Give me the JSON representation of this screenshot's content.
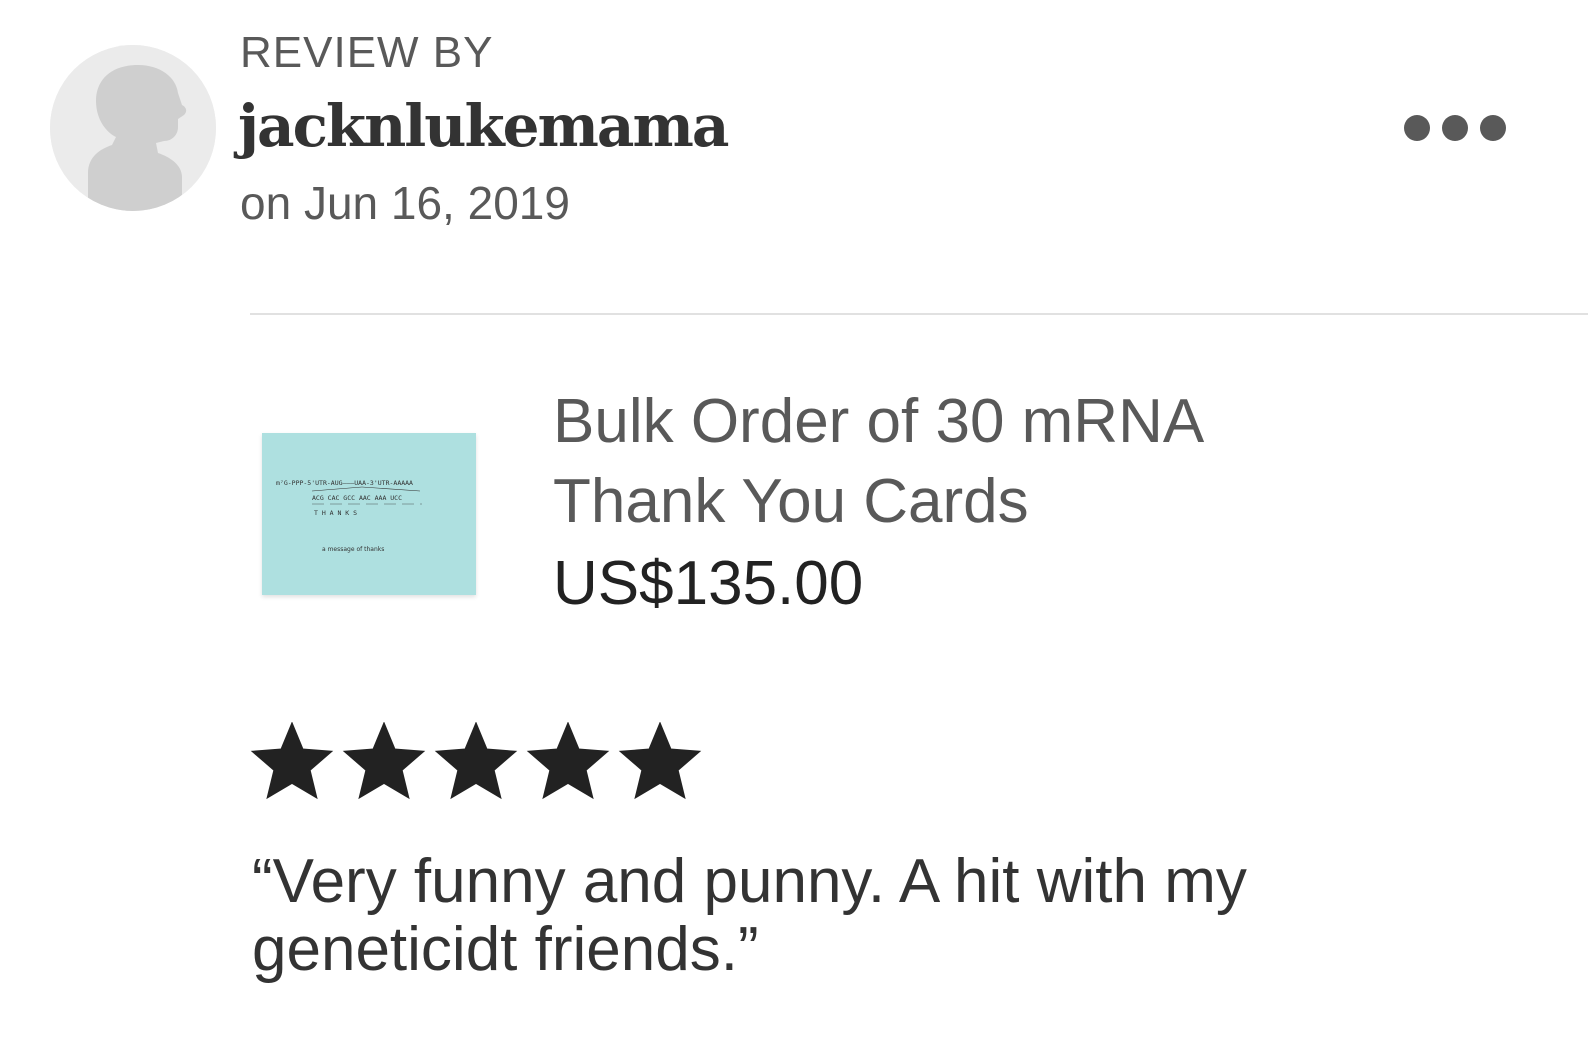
{
  "review": {
    "label": "REVIEW BY",
    "username": "jacknlukemama",
    "date": "on Jun 16, 2019",
    "rating": 5,
    "rating_max": 5,
    "text": "“Very funny and punny. A hit with my geneticidt friends.”"
  },
  "avatar": {
    "icon": "default-avatar-icon"
  },
  "more_menu": {
    "icon": "more-horizontal-icon"
  },
  "product": {
    "title": "Bulk Order of 30 mRNA Thank You Cards",
    "price": "US$135.00",
    "thumbnail": {
      "line1": "m⁷G-PPP-5'UTR-AUG———UAA-3'UTR-AAAAA",
      "line2": "ACG CAC GCC AAC AAA UCC",
      "line3": "T  H  A  N  K  S",
      "line4": "a message of thanks",
      "background": "#aee0e0"
    }
  },
  "colors": {
    "text_secondary": "#595959",
    "text_primary": "#222222",
    "star": "#222222",
    "divider": "#e1e1e1"
  }
}
